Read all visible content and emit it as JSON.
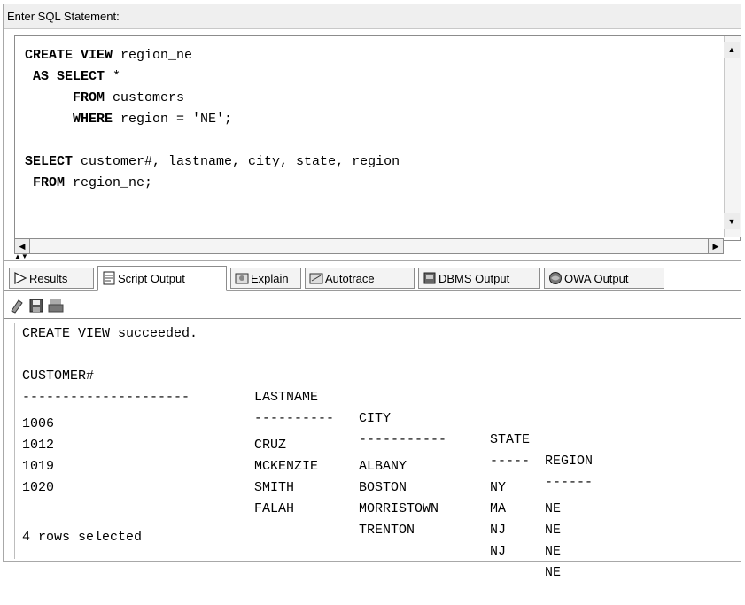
{
  "header": {
    "label": "Enter SQL Statement:"
  },
  "editor": {
    "lines": [
      {
        "kw": "CREATE VIEW",
        "rest": " region_ne"
      },
      {
        "kw": "AS SELECT",
        "rest": " *"
      },
      {
        "kw": "FROM",
        "rest": " customers"
      },
      {
        "kw": "WHERE",
        "rest": " region = 'NE';"
      },
      {
        "kw": "",
        "rest": ""
      },
      {
        "kw": "SELECT",
        "rest": " customer#, lastname, city, state, region"
      },
      {
        "kw": "FROM",
        "rest": " region_ne;"
      }
    ]
  },
  "tabs": [
    {
      "label": "Results",
      "icon": "play-icon"
    },
    {
      "label": "Script Output",
      "icon": "script-icon"
    },
    {
      "label": "Explain",
      "icon": "explain-icon"
    },
    {
      "label": "Autotrace",
      "icon": "autotrace-icon"
    },
    {
      "label": "DBMS Output",
      "icon": "dbms-icon"
    },
    {
      "label": "OWA Output",
      "icon": "owa-icon"
    }
  ],
  "toolbar": {
    "icons": [
      "eraser-icon",
      "save-icon",
      "print-icon"
    ]
  },
  "output": {
    "status": "CREATE VIEW succeeded.",
    "columns": [
      "CUSTOMER#",
      "LASTNAME",
      "CITY",
      "STATE",
      "REGION"
    ],
    "separators": [
      "---------------------",
      "----------",
      "-----------",
      "-----",
      "------"
    ],
    "rows": [
      [
        "1006",
        "CRUZ",
        "ALBANY",
        "NY",
        "NE"
      ],
      [
        "1012",
        "MCKENZIE",
        "BOSTON",
        "MA",
        "NE"
      ],
      [
        "1019",
        "SMITH",
        "MORRISTOWN",
        "NJ",
        "NE"
      ],
      [
        "1020",
        "FALAH",
        "TRENTON",
        "NJ",
        "NE"
      ]
    ],
    "footer": "4 rows selected"
  }
}
